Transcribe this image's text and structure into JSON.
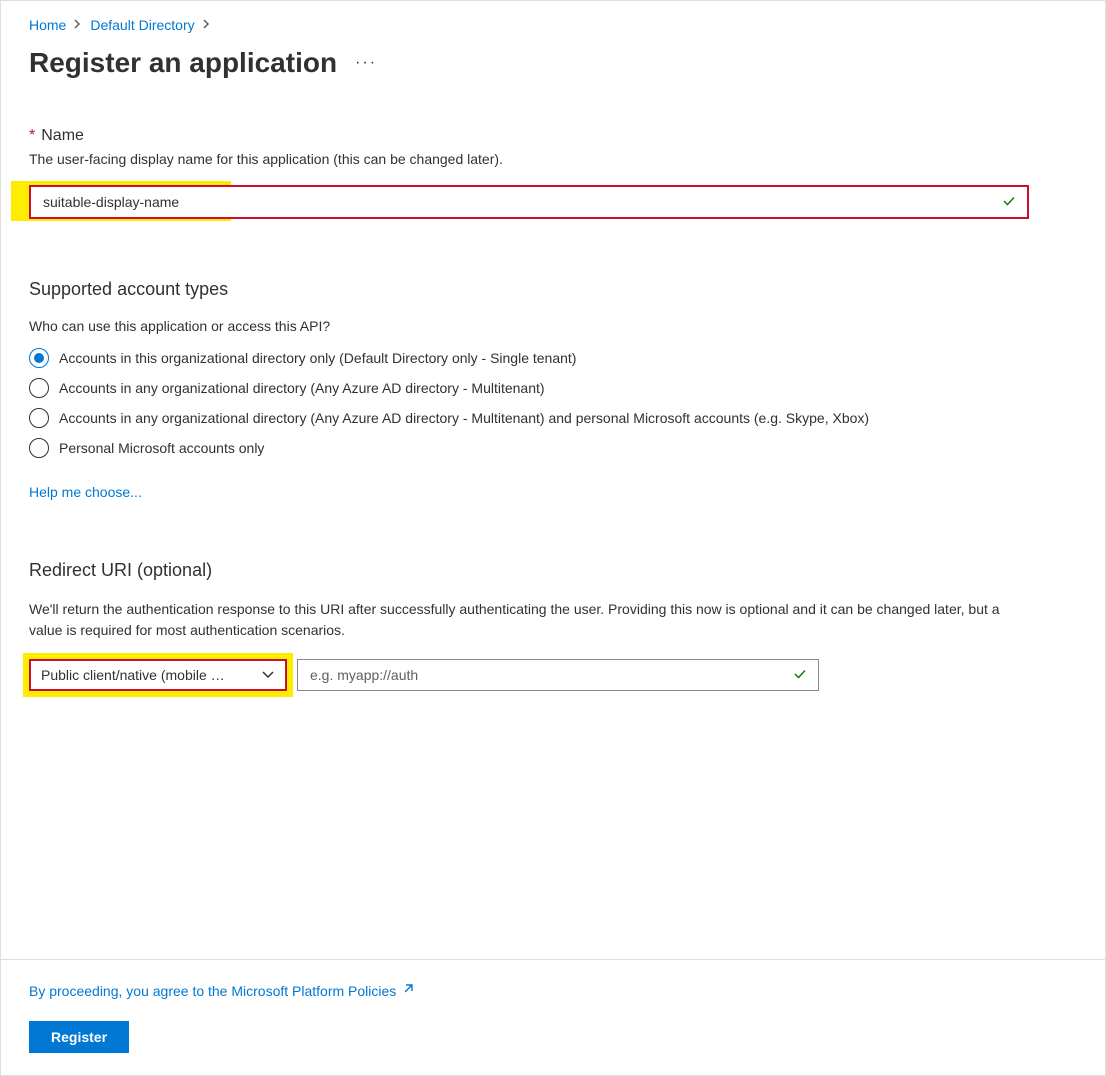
{
  "breadcrumb": {
    "home": "Home",
    "dir": "Default Directory"
  },
  "page_title": "Register an application",
  "name_section": {
    "label": "Name",
    "desc": "The user-facing display name for this application (this can be changed later).",
    "value": "suitable-display-name"
  },
  "account_types": {
    "heading": "Supported account types",
    "question": "Who can use this application or access this API?",
    "options": [
      "Accounts in this organizational directory only (Default Directory only - Single tenant)",
      "Accounts in any organizational directory (Any Azure AD directory - Multitenant)",
      "Accounts in any organizational directory (Any Azure AD directory - Multitenant) and personal Microsoft accounts (e.g. Skype, Xbox)",
      "Personal Microsoft accounts only"
    ],
    "help_link": "Help me choose..."
  },
  "redirect": {
    "heading": "Redirect URI (optional)",
    "desc": "We'll return the authentication response to this URI after successfully authenticating the user. Providing this now is optional and it can be changed later, but a value is required for most authentication scenarios.",
    "platform_label": "Public client/native (mobile …",
    "uri_placeholder": "e.g. myapp://auth"
  },
  "footer": {
    "policies": "By proceeding, you agree to the Microsoft Platform Policies",
    "register": "Register"
  }
}
